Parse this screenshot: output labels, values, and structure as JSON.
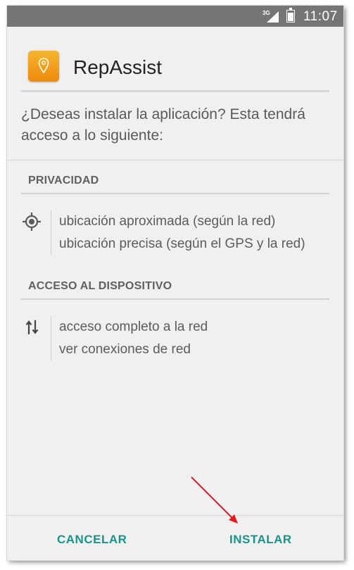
{
  "status_bar": {
    "network": "3G",
    "time": "11:07",
    "icons": [
      "signal-icon",
      "battery-icon"
    ]
  },
  "app": {
    "name": "RepAssist",
    "icon": "map-pin-icon",
    "icon_color": "#F2A01E"
  },
  "prompt": {
    "question": "¿Deseas instalar la aplicación? Esta tendrá acceso a lo siguiente:"
  },
  "sections": [
    {
      "title": "PRIVACIDAD",
      "icon": "location-target-icon",
      "items": [
        "ubicación aproximada (según la red)",
        "ubicación precisa (según el GPS y la red)"
      ]
    },
    {
      "title": "ACCESO AL DISPOSITIVO",
      "icon": "data-transfer-icon",
      "items": [
        "acceso completo a la red",
        "ver conexiones de red"
      ]
    }
  ],
  "buttons": {
    "cancel": "CANCELAR",
    "install": "INSTALAR"
  },
  "colors": {
    "accent": "#17958A",
    "annotation_arrow": "#E8191E"
  }
}
